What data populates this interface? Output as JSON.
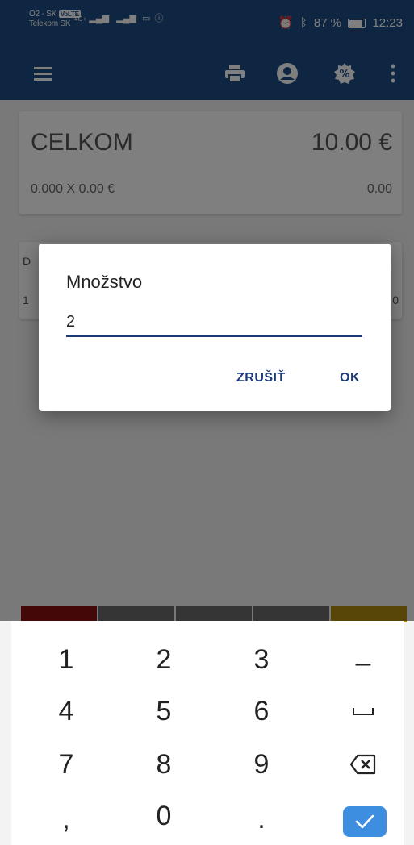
{
  "status_bar": {
    "carrier_1": "O2 - SK",
    "carrier_2": "Telekom SK",
    "volte": "VoLTE",
    "network": "4G+",
    "battery": "87 %",
    "time": "12:23"
  },
  "toolbar": {
    "icons": [
      "menu-icon",
      "print-icon",
      "account-icon",
      "discount-icon",
      "more-vert-icon"
    ]
  },
  "summary": {
    "total_label": "CELKOM",
    "total_value": "10.00 €",
    "calc_text": "0.000  X  0.00  €",
    "calc_value": "0.00"
  },
  "item_card": {
    "label_partial": "D",
    "qty_partial": "1",
    "value_partial": "0"
  },
  "color_strip": {
    "colors": [
      "#8b1010",
      "#6a6a6a",
      "#6a6a6a",
      "#6a6a6a",
      "#b08a10"
    ]
  },
  "dialog": {
    "title": "Množstvo",
    "input_value": "2",
    "cancel_label": "ZRUŠIŤ",
    "ok_label": "OK"
  },
  "keyboard": {
    "keys": [
      {
        "label": "1",
        "name": "key-1"
      },
      {
        "label": "2",
        "name": "key-2"
      },
      {
        "label": "3",
        "name": "key-3"
      },
      {
        "label": "–",
        "name": "key-minus"
      },
      {
        "label": "4",
        "name": "key-4"
      },
      {
        "label": "5",
        "name": "key-5"
      },
      {
        "label": "6",
        "name": "key-6"
      },
      {
        "label": "␣",
        "name": "key-space"
      },
      {
        "label": "7",
        "name": "key-7"
      },
      {
        "label": "8",
        "name": "key-8"
      },
      {
        "label": "9",
        "name": "key-9"
      },
      {
        "label": "⌫",
        "name": "key-backspace"
      },
      {
        "label": ",",
        "name": "key-comma"
      },
      {
        "label": "0",
        "name": "key-0"
      },
      {
        "label": ".",
        "name": "key-period"
      }
    ],
    "done_icon": "check-icon"
  },
  "colors": {
    "primary": "#1d4d85",
    "dialog_accent": "#1d3a78",
    "done_key": "#3d8de0"
  }
}
